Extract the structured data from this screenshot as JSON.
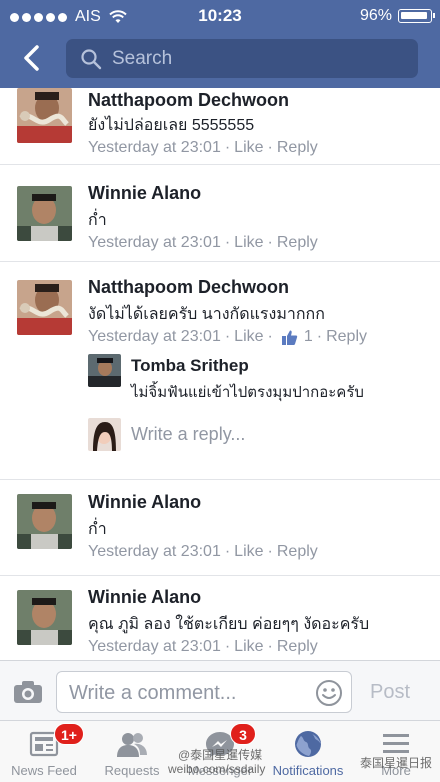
{
  "status_bar": {
    "carrier": "AIS",
    "time": "10:23",
    "battery": "96%"
  },
  "header": {
    "search_placeholder": "Search"
  },
  "comments": [
    {
      "name": "Natthapoom Dechwoon",
      "text": "ยังไม่ปล่อยเลย 5555555",
      "time": "Yesterday at 23:01",
      "like_label": "Like",
      "reply_label": "Reply"
    },
    {
      "name": "Winnie Alano",
      "text": "ก่ำ",
      "time": "Yesterday at 23:01",
      "like_label": "Like",
      "reply_label": "Reply"
    },
    {
      "name": "Natthapoom Dechwoon",
      "text": "งัดไม่ได้เลยครับ นางกัดแรงมากกก",
      "time": "Yesterday at 23:01",
      "like_label": "Like",
      "like_count": "1",
      "reply_label": "Reply",
      "reply": {
        "name": "Tomba Srithep",
        "text": "ไม่จิ้มฟันแย่เข้าไปตรงมุมปากอะครับ"
      },
      "write_reply_placeholder": "Write a reply..."
    },
    {
      "name": "Winnie Alano",
      "text": "ก่ำ",
      "time": "Yesterday at 23:01",
      "like_label": "Like",
      "reply_label": "Reply"
    },
    {
      "name": "Winnie Alano",
      "text": "คุณ ภูมิ ลอง ใช้ตะเกียบ ค่อยๆๆ งัดอะครับ",
      "time": "Yesterday at 23:01",
      "like_label": "Like",
      "reply_label": "Reply"
    }
  ],
  "composer": {
    "placeholder": "Write a comment...",
    "post_label": "Post"
  },
  "tabs": [
    {
      "label": "News Feed",
      "badge": "1+"
    },
    {
      "label": "Requests"
    },
    {
      "label": "Messenger",
      "badge": "3"
    },
    {
      "label": "Notifications"
    },
    {
      "label": "More"
    }
  ],
  "watermarks": {
    "left": "@泰国星暹传媒",
    "left_sub": "weibo.com/ssdaily",
    "right": "泰国星暹日报"
  },
  "colors": {
    "header_blue": "#4e69a2",
    "search_field": "#3b5283",
    "meta_gray": "#9197a3",
    "badge_red": "#e0201b"
  }
}
